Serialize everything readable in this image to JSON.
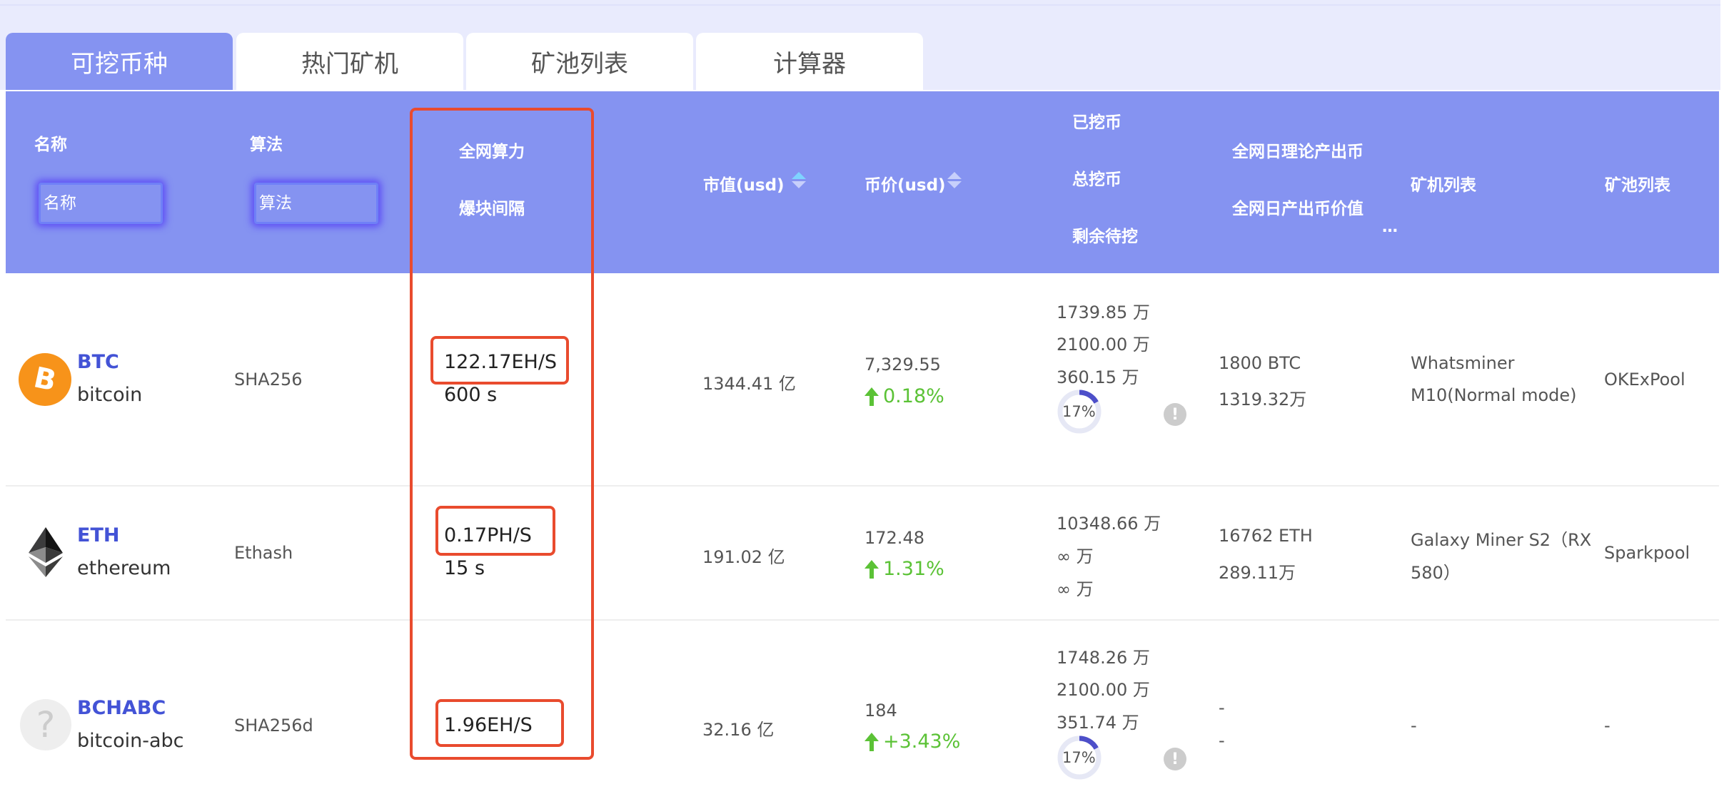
{
  "tabs": [
    {
      "label": "可挖币种",
      "active": true
    },
    {
      "label": "热门矿机",
      "active": false
    },
    {
      "label": "矿池列表",
      "active": false
    },
    {
      "label": "计算器",
      "active": false
    }
  ],
  "header": {
    "name_label": "名称",
    "name_placeholder": "名称",
    "algo_label": "算法",
    "algo_placeholder": "算法",
    "hashrate_label": "全网算力",
    "block_interval_label": "爆块间隔",
    "market_cap_label": "市值(usd)",
    "price_label": "币价(usd)",
    "mined_label": "已挖币",
    "total_label": "总挖币",
    "remaining_label": "剩余待挖",
    "daily_theory_label": "全网日理论产出币",
    "daily_value_label": "全网日产出币价值",
    "ellipsis": "…",
    "miner_list_label": "矿机列表",
    "pool_list_label": "矿池列表"
  },
  "rows": [
    {
      "symbol": "BTC",
      "name": "bitcoin",
      "algo": "SHA256",
      "hashrate": "122.17EH/S",
      "interval": "600 s",
      "market_cap": "1344.41 亿",
      "price": "7,329.55",
      "change": "0.18%",
      "mined": "1739.85 万",
      "total": "2100.00 万",
      "remaining": "360.15 万",
      "progress_pct": 17,
      "progress_label": "17%",
      "info": "!",
      "daily_coins": "1800 BTC",
      "daily_value": "1319.32万",
      "miner_line1": "Whatsminer",
      "miner_line2": "M10(Normal mode)",
      "pool": "OKExPool",
      "icon": "bitcoin-icon"
    },
    {
      "symbol": "ETH",
      "name": "ethereum",
      "algo": "Ethash",
      "hashrate": "0.17PH/S",
      "interval": "15 s",
      "market_cap": "191.02 亿",
      "price": "172.48",
      "change": "1.31%",
      "mined": "10348.66 万",
      "total": "∞ 万",
      "remaining": "∞ 万",
      "daily_coins": "16762 ETH",
      "daily_value": "289.11万",
      "miner_line1": "Galaxy Miner S2（RX",
      "miner_line2": "580）",
      "pool": "Sparkpool",
      "icon": "ethereum-icon"
    },
    {
      "symbol": "BCHABC",
      "name": "bitcoin-abc",
      "algo": "SHA256d",
      "hashrate": "1.96EH/S",
      "market_cap": "32.16 亿",
      "price": "184",
      "change": "+3.43%",
      "mined": "1748.26 万",
      "total": "2100.00 万",
      "remaining": "351.74 万",
      "progress_pct": 17,
      "progress_label": "17%",
      "info": "!",
      "daily_coins": "-",
      "daily_value": "-",
      "miner_line1": "-",
      "pool": "-",
      "icon_glyph": "?",
      "icon": "unknown-coin-icon"
    }
  ],
  "colors": {
    "accent": "#8593f1",
    "link": "#4353d6",
    "positive": "#5bc236",
    "highlight": "#e94b2e"
  }
}
